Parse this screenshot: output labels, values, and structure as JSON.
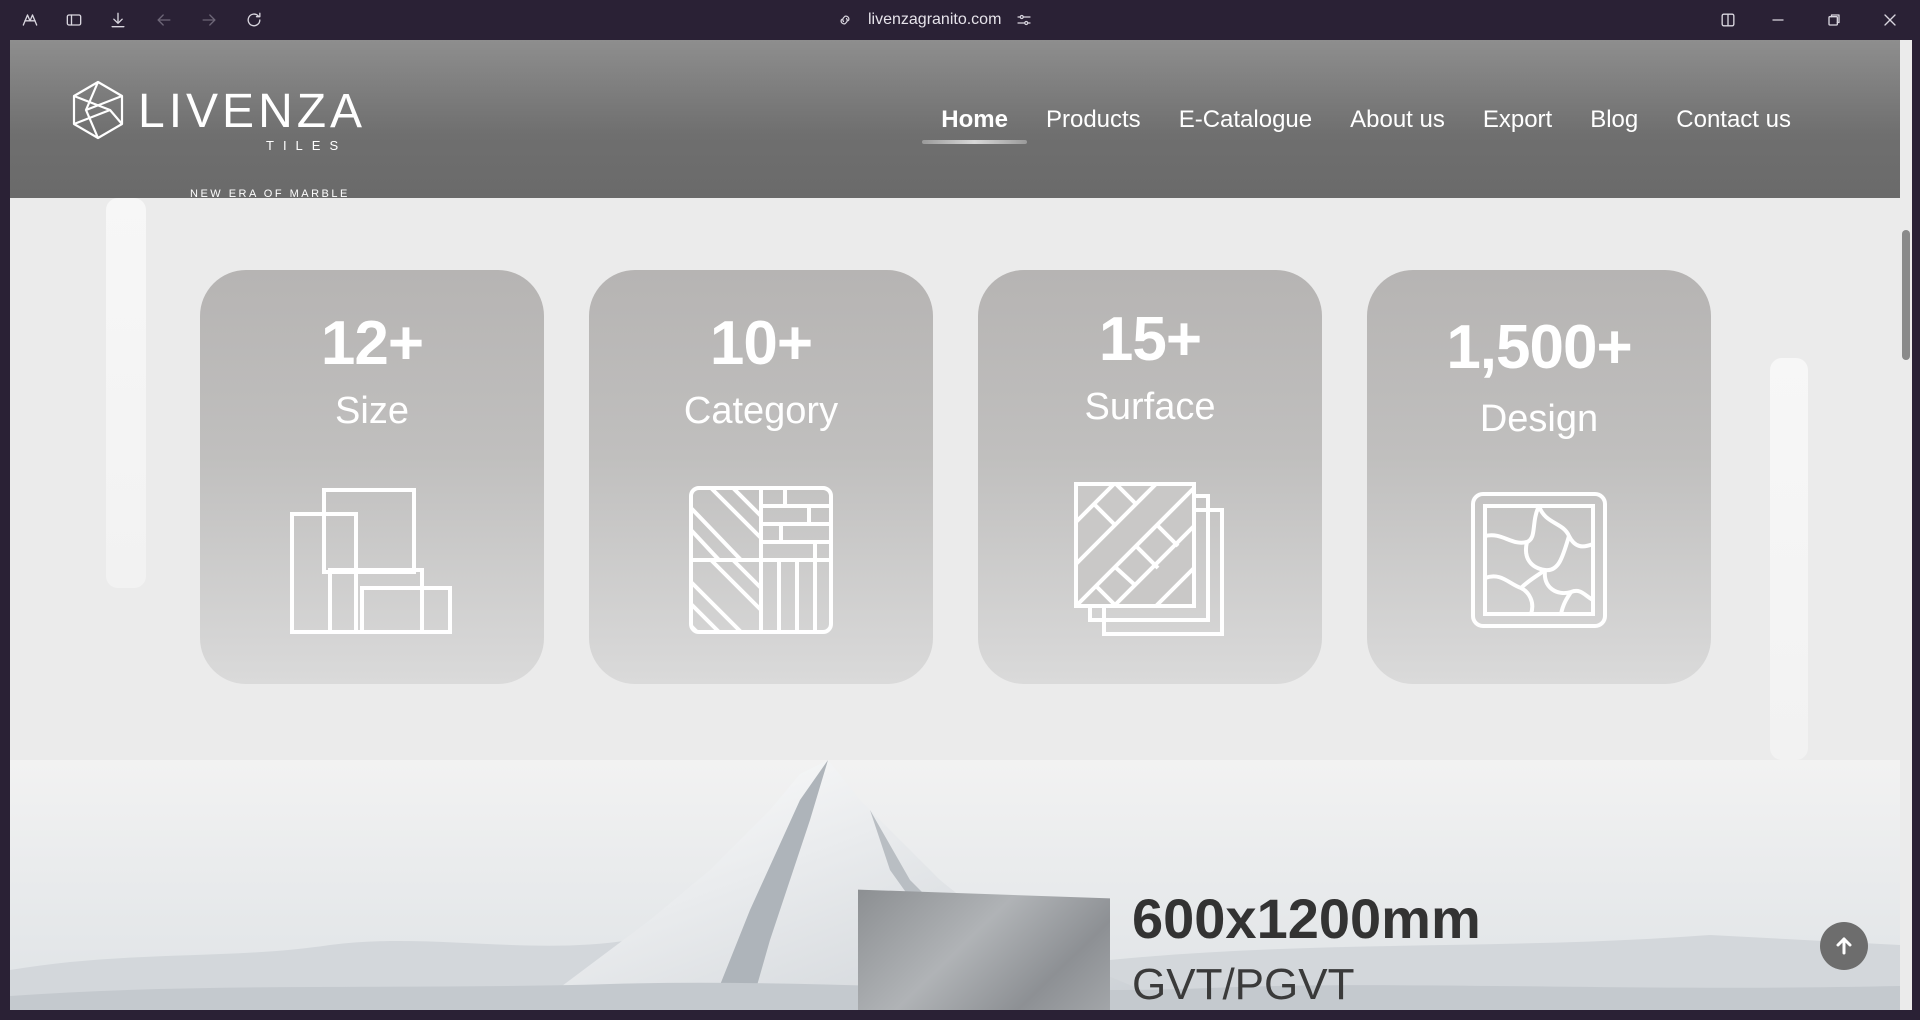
{
  "browser": {
    "url": "livenzagranito.com",
    "icons": [
      "app-menu-icon",
      "sidebar-icon",
      "download-icon",
      "back-icon",
      "forward-icon",
      "reload-icon",
      "link-icon",
      "site-settings-icon",
      "split-view-icon",
      "minimize-icon",
      "restore-icon",
      "close-icon"
    ]
  },
  "header": {
    "logo_word": "LIVENZA",
    "logo_sub": "TILES",
    "logo_tagline": "NEW ERA OF MARBLE",
    "nav": [
      {
        "label": "Home",
        "active": true
      },
      {
        "label": "Products"
      },
      {
        "label": "E-Catalogue"
      },
      {
        "label": "About us"
      },
      {
        "label": "Export"
      },
      {
        "label": "Blog"
      },
      {
        "label": "Contact us"
      }
    ]
  },
  "stats": [
    {
      "value": "12+",
      "label": "Size",
      "icon": "tile-sizes-icon"
    },
    {
      "value": "10+",
      "label": "Category",
      "icon": "tile-pattern-icon"
    },
    {
      "value": "15+",
      "label": "Surface",
      "icon": "tile-stack-icon"
    },
    {
      "value": "1,500+",
      "label": "Design",
      "icon": "marble-design-icon"
    }
  ],
  "hero": {
    "size": "600x1200mm",
    "type": "GVT/PGVT"
  },
  "colors": {
    "header_bg": "#6f6f6f",
    "card_bg": "#b6b4b3",
    "page_bg": "#ebebeb",
    "chrome_bg": "#2a2135"
  }
}
